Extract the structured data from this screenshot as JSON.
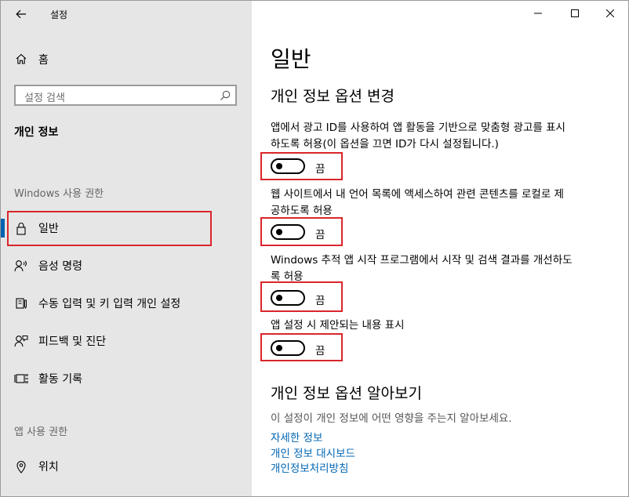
{
  "window": {
    "title": "설정"
  },
  "sidebar": {
    "home_label": "홈",
    "search_placeholder": "설정 검색",
    "heading": "개인 정보",
    "section_windows": "Windows 사용 권한",
    "items": [
      {
        "label": "일반",
        "icon": "lock-icon",
        "selected": true
      },
      {
        "label": "음성 명령",
        "icon": "speech-icon",
        "selected": false
      },
      {
        "label": "수동 입력 및 키 입력 개인 설정",
        "icon": "pen-icon",
        "selected": false
      },
      {
        "label": "피드백 및 진단",
        "icon": "feedback-icon",
        "selected": false
      },
      {
        "label": "활동 기록",
        "icon": "timeline-icon",
        "selected": false
      }
    ],
    "section_app": "앱 사용 권한",
    "app_items": [
      {
        "label": "위치",
        "icon": "location-icon"
      }
    ]
  },
  "main": {
    "title": "일반",
    "change_title": "개인 정보 옵션 변경",
    "settings": [
      {
        "desc_line1": "앱에서 광고 ID를 사용하여 앱 활동을 기반으로 맞춤형 광고를 표시",
        "desc_line2": "하도록 허용(이 옵션을 끄면 ID가 다시 설정됩니다.)",
        "state": "끔",
        "on": false
      },
      {
        "desc_line1": "웹 사이트에서 내 언어 목록에 액세스하여 관련 콘텐츠를 로컬로 제",
        "desc_line2": "공하도록 허용",
        "state": "끔",
        "on": false
      },
      {
        "desc_line1": "Windows 추적 앱 시작 프로그램에서 시작 및 검색 결과를 개선하도",
        "desc_line2": "록 허용",
        "state": "끔",
        "on": false
      },
      {
        "desc_line1": "앱 설정 시 제안되는 내용 표시",
        "desc_line2": "",
        "state": "끔",
        "on": false
      }
    ],
    "about_title": "개인 정보 옵션 알아보기",
    "about_desc": "이 설정이 개인 정보에 어떤 영향을 주는지 알아보세요.",
    "links": [
      "자세한 정보",
      "개인 정보 대시보드",
      "개인정보처리방침"
    ]
  },
  "colors": {
    "accent": "#0063b1",
    "link": "#0066b4",
    "highlight": "#d9262b",
    "sidebar_bg": "#e6e6e6"
  }
}
